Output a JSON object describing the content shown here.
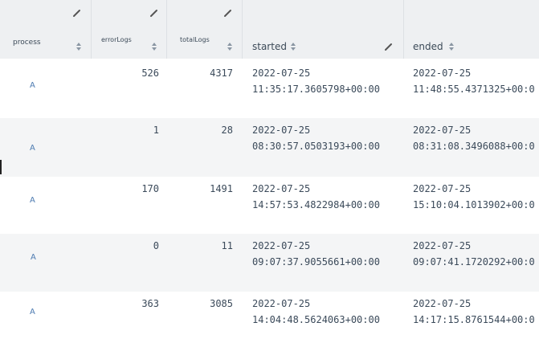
{
  "columns": {
    "process": "process",
    "errorLogs": "errorLogs",
    "totalLogs": "totalLogs",
    "started": "started",
    "ended": "ended"
  },
  "rows": [
    {
      "process": "A",
      "errorLogs": "526",
      "totalLogs": "4317",
      "started_date": "2022-07-25",
      "started_time": "11:35:17.3605798+00:00",
      "ended_date": "2022-07-25",
      "ended_time": "11:48:55.4371325+00:0"
    },
    {
      "process": "A",
      "errorLogs": "1",
      "totalLogs": "28",
      "started_date": "2022-07-25",
      "started_time": "08:30:57.0503193+00:00",
      "ended_date": "2022-07-25",
      "ended_time": "08:31:08.3496088+00:0"
    },
    {
      "process": "A",
      "errorLogs": "170",
      "totalLogs": "1491",
      "started_date": "2022-07-25",
      "started_time": "14:57:53.4822984+00:00",
      "ended_date": "2022-07-25",
      "ended_time": "15:10:04.1013902+00:0"
    },
    {
      "process": "A",
      "errorLogs": "0",
      "totalLogs": "11",
      "started_date": "2022-07-25",
      "started_time": "09:07:37.9055661+00:00",
      "ended_date": "2022-07-25",
      "ended_time": "09:07:41.1720292+00:0"
    },
    {
      "process": "A",
      "errorLogs": "363",
      "totalLogs": "3085",
      "started_date": "2022-07-25",
      "started_time": "14:04:48.5624063+00:00",
      "ended_date": "2022-07-25",
      "ended_time": "14:17:15.8761544+00:0"
    }
  ]
}
